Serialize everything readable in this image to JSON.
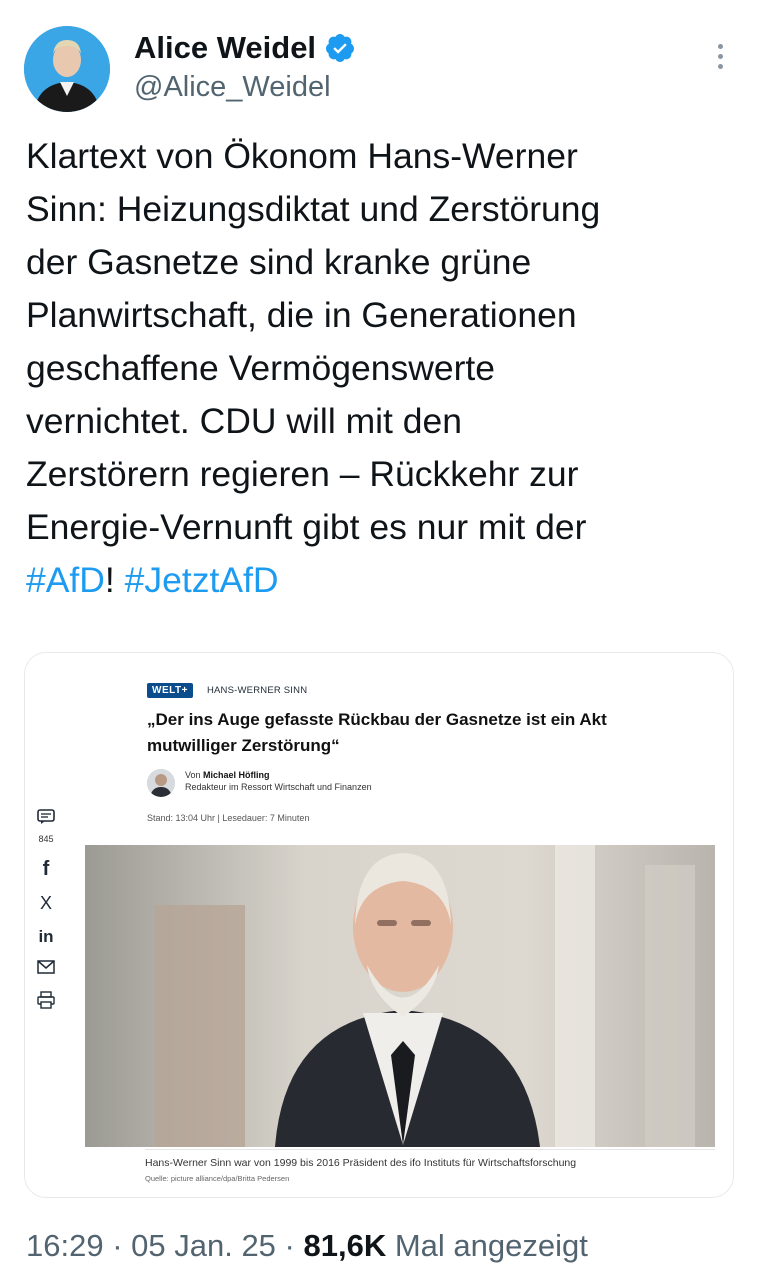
{
  "author": {
    "display_name": "Alice Weidel",
    "handle": "@Alice_Weidel",
    "verified_icon": "verified-badge-icon",
    "badge_color": "#1d9bf0"
  },
  "tweet": {
    "lines": [
      "Klartext von Ökonom Hans-Werner",
      "Sinn: Heizungsdiktat und Zerstörung",
      "der Gasnetze sind kranke grüne",
      "Planwirtschaft, die in Generationen",
      "geschaffene Vermögenswerte",
      "vernichtet. CDU will mit den",
      "Zerstörern regieren – Rückkehr zur",
      "Energie-Vernunft gibt es nur mit der"
    ],
    "hashtag_1": "#AfD",
    "separator": "! ",
    "hashtag_2": "#JetztAfD",
    "hashtag_color": "#1d9bf0"
  },
  "card": {
    "brand": "WELT+",
    "topic": "HANS-WERNER SINN",
    "headline": "„Der ins Auge gefasste Rückbau der Gasnetze ist ein Akt mutwilliger Zerstörung“",
    "author_prefix": "Von",
    "author_name": "Michael Höfling",
    "author_role": "Redakteur im Ressort Wirtschaft und Finanzen",
    "stand": "Stand: 13:04 Uhr | Lesedauer: 7 Minuten",
    "comment_count": "845",
    "caption": "Hans-Werner Sinn war von 1999 bis 2016 Präsident des ifo Instituts für Wirtschaftsforschung",
    "credit": "Quelle: picture alliance/dpa/Britta Pedersen",
    "share_icons": [
      "comment-icon",
      "facebook-icon",
      "x-icon",
      "linkedin-icon",
      "mail-icon",
      "print-icon"
    ],
    "share_labels": {
      "facebook": "f",
      "x": "X",
      "linkedin": "in"
    }
  },
  "meta": {
    "time": "16:29",
    "dot1": " · ",
    "date": "05 Jan. 25",
    "dot2": " · ",
    "views": "81,6K",
    "views_label": " Mal angezeigt"
  }
}
